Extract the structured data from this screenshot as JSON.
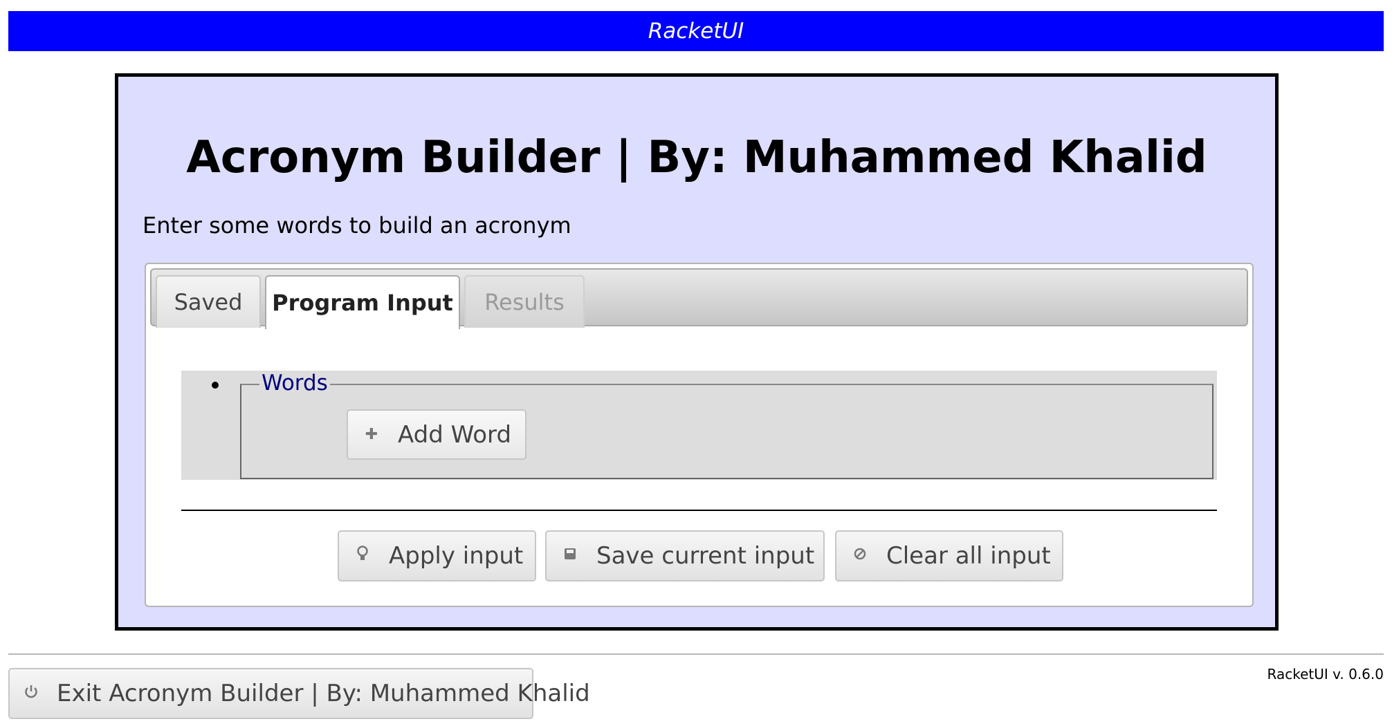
{
  "header": {
    "title": "RacketUI"
  },
  "app": {
    "title": "Acronym Builder | By: Muhammed Khalid",
    "description": "Enter some words to build an acronym"
  },
  "tabs": [
    {
      "label": "Saved",
      "state": "normal"
    },
    {
      "label": "Program Input",
      "state": "active"
    },
    {
      "label": "Results",
      "state": "disabled"
    }
  ],
  "form": {
    "fieldset_legend": "Words",
    "add_button": {
      "label": "Add Word",
      "icon": "plus-icon"
    }
  },
  "actions": [
    {
      "label": "Apply input",
      "icon": "lightbulb-icon"
    },
    {
      "label": "Save current input",
      "icon": "save-icon"
    },
    {
      "label": "Clear all input",
      "icon": "cancel-icon"
    }
  ],
  "footer": {
    "exit_label": "Exit Acronym Builder | By: Muhammed Khalid",
    "exit_icon": "power-icon",
    "version": "RacketUI v. 0.6.0"
  },
  "colors": {
    "header_bg": "#0000ff",
    "frame_bg": "#ddddff",
    "legend_text": "#000080"
  }
}
